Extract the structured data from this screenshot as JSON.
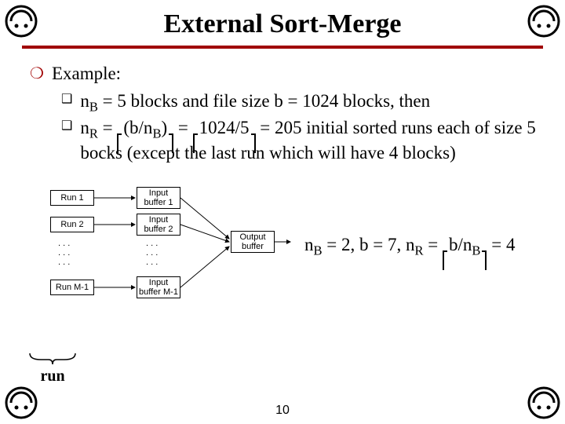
{
  "title": "External Sort-Merge",
  "example_label": "Example:",
  "bullet1_pre": "n",
  "bullet1_sub": "B",
  "bullet1_rest": " = 5 blocks and file size b = 1024 blocks, then",
  "bullet2_pre": "n",
  "bullet2_sub": "R",
  "bullet2_eq": " = ",
  "bullet2_ceil1_inner_a": "(b/n",
  "bullet2_ceil1_inner_sub": "B",
  "bullet2_ceil1_inner_b": ")",
  "bullet2_eq2": " = ",
  "bullet2_ceil2_inner": "1024/5",
  "bullet2_tail": " = 205 initial sorted runs each of size 5 bocks (except the last run which will have 4 blocks)",
  "fig": {
    "run1": "Run 1",
    "run2": "Run 2",
    "runM": "Run M-1",
    "ib1": "Input buffer 1",
    "ib2": "Input buffer 2",
    "ibM": "Input buffer M-1",
    "out": "Output buffer"
  },
  "right_nB_pre": "n",
  "right_nB_sub": "B",
  "right_mid": " = 2, b = 7, n",
  "right_nR_sub": "R",
  "right_eq": " = ",
  "right_ceil_inner_a": "b/n",
  "right_ceil_inner_sub": "B",
  "right_tail": " = 4",
  "run_label": "run",
  "page_number": "10"
}
